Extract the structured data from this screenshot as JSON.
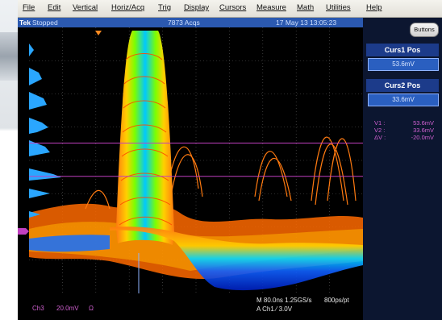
{
  "menu": [
    "File",
    "Edit",
    "Vertical",
    "Horiz/Acq",
    "Trig",
    "Display",
    "Cursors",
    "Measure",
    "Math",
    "Utilities",
    "Help"
  ],
  "status": {
    "brand": "Tek",
    "state": "Stopped",
    "acqs": "7873 Acqs",
    "datetime": "17 May 13 13:05:23"
  },
  "panel": {
    "buttons_label": "Buttons",
    "curs1_label": "Curs1 Pos",
    "curs1_value": "53.6mV",
    "curs2_label": "Curs2 Pos",
    "curs2_value": "33.6mV",
    "readouts": [
      {
        "key": "V1 :",
        "value": "53.6mV"
      },
      {
        "key": "V2 :",
        "value": "33.6mV"
      },
      {
        "key": "ΔV :",
        "value": "-20.0mV"
      }
    ]
  },
  "footer": {
    "channel": "Ch3",
    "scale": "20.0mV",
    "ohm": "Ω",
    "timebase": "M 80.0ns 1.25GS/s",
    "ps_pt": "800ps/pt",
    "trigger": "A  Ch1  ⁄  3.0V"
  },
  "colors": {
    "status_bar": "#2b59b0",
    "panel_bg": "#0c1630",
    "cursor_line": "#c040c0",
    "histogram": "#2aa6ff",
    "trace_hot": "#ff7a10",
    "trace_warm": "#ffd000",
    "trace_mid": "#00d000",
    "trace_cool": "#0040ff"
  }
}
